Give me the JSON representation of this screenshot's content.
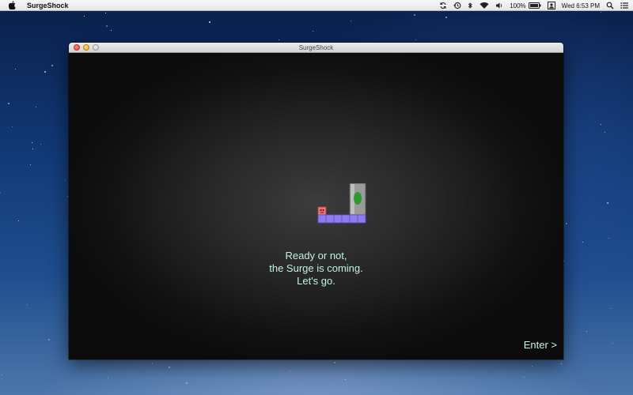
{
  "menubar": {
    "app_name": "SurgeShock",
    "battery_text": "100%",
    "clock": "Wed 6:53 PM",
    "icons": [
      "apple-icon",
      "sync-icon",
      "time-machine-icon",
      "bluetooth-icon",
      "wifi-icon",
      "volume-icon",
      "battery-icon",
      "user-icon",
      "spotlight-icon",
      "notification-list-icon"
    ]
  },
  "window": {
    "title": "SurgeShock"
  },
  "game": {
    "story_lines": [
      "Ready or not,",
      "the Surge is coming.",
      "Let's go."
    ],
    "enter_label": "Enter >",
    "colors": {
      "text": "#bff3e6",
      "platform": "#8c7cf0",
      "player": "#f07070",
      "pillar": "#a0a0a0",
      "portal": "#2e9a2e"
    }
  }
}
